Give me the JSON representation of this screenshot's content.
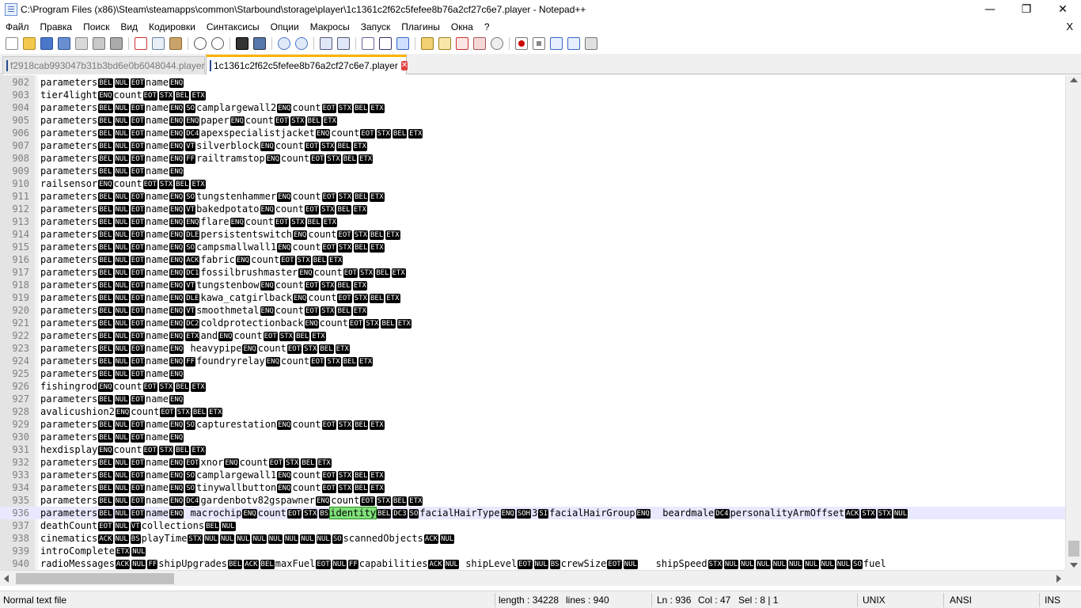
{
  "window": {
    "title": "C:\\Program Files (x86)\\Steam\\steamapps\\common\\Starbound\\storage\\player\\1c1361c2f62c5fefee8b76a2cf27c6e7.player - Notepad++",
    "minimize": "—",
    "maximize": "❐",
    "close": "✕"
  },
  "menu": {
    "items": [
      "Файл",
      "Правка",
      "Поиск",
      "Вид",
      "Кодировки",
      "Синтаксисы",
      "Опции",
      "Макросы",
      "Запуск",
      "Плагины",
      "Окна",
      "?"
    ],
    "close_doc": "X"
  },
  "toolbar": {
    "icons": [
      "new-file-icon",
      "open-file-icon",
      "save-icon",
      "save-all-icon",
      "close-icon",
      "close-all-icon",
      "print-icon",
      "cut-icon",
      "copy-icon",
      "paste-icon",
      "undo-icon",
      "redo-icon",
      "find-icon",
      "replace-icon",
      "zoom-in-icon",
      "zoom-out-icon",
      "sync-vertical-icon",
      "sync-horizontal-icon",
      "word-wrap-icon",
      "show-all-characters-icon",
      "indent-guide-icon",
      "user-defined-language-icon",
      "document-map-icon",
      "function-list-icon",
      "folder-as-workspace-icon",
      "monitoring-icon",
      "record-macro-icon",
      "stop-recording-icon",
      "playback-macro-icon",
      "run-macro-multiple-icon",
      "save-macro-icon"
    ]
  },
  "tabs": [
    {
      "label": "f2918cab993047b31b3bd6e0b6048044.player",
      "active": false
    },
    {
      "label": "1c1361c2f62c5fefee8b76a2cf27c6e7.player",
      "active": true,
      "close": "✕"
    }
  ],
  "editor": {
    "lines": [
      {
        "n": "902",
        "t": "parameters[BEL][NUL][EOT]name[ENQ]"
      },
      {
        "n": "903",
        "t": "tier4light[ENQ]count[EOT][STX][BEL][ETX]"
      },
      {
        "n": "904",
        "t": "parameters[BEL][NUL][EOT]name[ENQ][SO]camplargewall2[ENQ]count[EOT][STX][BEL][ETX]"
      },
      {
        "n": "905",
        "t": "parameters[BEL][NUL][EOT]name[ENQ][ENQ]paper[ENQ]count[EOT][STX][BEL][ETX]"
      },
      {
        "n": "906",
        "t": "parameters[BEL][NUL][EOT]name[ENQ][DC4]apexspecialistjacket[ENQ]count[EOT][STX][BEL][ETX]"
      },
      {
        "n": "907",
        "t": "parameters[BEL][NUL][EOT]name[ENQ][VT]silverblock[ENQ]count[EOT][STX][BEL][ETX]"
      },
      {
        "n": "908",
        "t": "parameters[BEL][NUL][EOT]name[ENQ][FF]railtramstop[ENQ]count[EOT][STX][BEL][ETX]"
      },
      {
        "n": "909",
        "t": "parameters[BEL][NUL][EOT]name[ENQ]"
      },
      {
        "n": "910",
        "t": "railsensor[ENQ]count[EOT][STX][BEL][ETX]"
      },
      {
        "n": "911",
        "t": "parameters[BEL][NUL][EOT]name[ENQ][SO]tungstenhammer[ENQ]count[EOT][STX][BEL][ETX]"
      },
      {
        "n": "912",
        "t": "parameters[BEL][NUL][EOT]name[ENQ][VT]bakedpotato[ENQ]count[EOT][STX][BEL][ETX]"
      },
      {
        "n": "913",
        "t": "parameters[BEL][NUL][EOT]name[ENQ][ENQ]flare[ENQ]count[EOT][STX][BEL][ETX]"
      },
      {
        "n": "914",
        "t": "parameters[BEL][NUL][EOT]name[ENQ][DLE]persistentswitch[ENQ]count[EOT][STX][BEL][ETX]"
      },
      {
        "n": "915",
        "t": "parameters[BEL][NUL][EOT]name[ENQ][SO]campsmallwall1[ENQ]count[EOT][STX][BEL][ETX]"
      },
      {
        "n": "916",
        "t": "parameters[BEL][NUL][EOT]name[ENQ][ACK]fabric[ENQ]count[EOT][STX][BEL][ETX]"
      },
      {
        "n": "917",
        "t": "parameters[BEL][NUL][EOT]name[ENQ][DC1]fossilbrushmaster[ENQ]count[EOT][STX][BEL][ETX]"
      },
      {
        "n": "918",
        "t": "parameters[BEL][NUL][EOT]name[ENQ][VT]tungstenbow[ENQ]count[EOT][STX][BEL][ETX]"
      },
      {
        "n": "919",
        "t": "parameters[BEL][NUL][EOT]name[ENQ][DLE]kawa_catgirlback[ENQ]count[EOT][STX][BEL][ETX]"
      },
      {
        "n": "920",
        "t": "parameters[BEL][NUL][EOT]name[ENQ][VT]smoothmetal[ENQ]count[EOT][STX][BEL][ETX]"
      },
      {
        "n": "921",
        "t": "parameters[BEL][NUL][EOT]name[ENQ][DC2]coldprotectionback[ENQ]count[EOT][STX][BEL][ETX]"
      },
      {
        "n": "922",
        "t": "parameters[BEL][NUL][EOT]name[ENQ][ETX]and[ENQ]count[EOT][STX][BEL][ETX]"
      },
      {
        "n": "923",
        "t": "parameters[BEL][NUL][EOT]name[ENQ] heavypipe[ENQ]count[EOT][STX][BEL][ETX]"
      },
      {
        "n": "924",
        "t": "parameters[BEL][NUL][EOT]name[ENQ][FF]foundryrelay[ENQ]count[EOT][STX][BEL][ETX]"
      },
      {
        "n": "925",
        "t": "parameters[BEL][NUL][EOT]name[ENQ]"
      },
      {
        "n": "926",
        "t": "fishingrod[ENQ]count[EOT][STX][BEL][ETX]"
      },
      {
        "n": "927",
        "t": "parameters[BEL][NUL][EOT]name[ENQ]"
      },
      {
        "n": "928",
        "t": "avalicushion2[ENQ]count[EOT][STX][BEL][ETX]"
      },
      {
        "n": "929",
        "t": "parameters[BEL][NUL][EOT]name[ENQ][SO]capturestation[ENQ]count[EOT][STX][BEL][ETX]"
      },
      {
        "n": "930",
        "t": "parameters[BEL][NUL][EOT]name[ENQ]"
      },
      {
        "n": "931",
        "t": "hexdisplay[ENQ]count[EOT][STX][BEL][ETX]"
      },
      {
        "n": "932",
        "t": "parameters[BEL][NUL][EOT]name[ENQ][EOT]xnor[ENQ]count[EOT][STX][BEL][ETX]"
      },
      {
        "n": "933",
        "t": "parameters[BEL][NUL][EOT]name[ENQ][SO]camplargewall1[ENQ]count[EOT][STX][BEL][ETX]"
      },
      {
        "n": "934",
        "t": "parameters[BEL][NUL][EOT]name[ENQ][SO]tinywallbutton[ENQ]count[EOT][STX][BEL][ETX]"
      },
      {
        "n": "935",
        "t": "parameters[BEL][NUL][EOT]name[ENQ][DC4]gardenbotv82gspawner[ENQ]count[EOT][STX][BEL][ETX]"
      },
      {
        "n": "936",
        "t": "parameters[BEL][NUL][EOT]name[ENQ] macrochip[ENQ]count[EOT][STX][BS]{identity}[BEL][DC3][SO]facialHairType[ENQ][SOH]3[SI]facialHairGroup[ENQ]  beardmale[DC4]personalityArmOffset[ACK][STX][STX][NUL]",
        "current": true
      },
      {
        "n": "937",
        "t": "deathCount[EOT][NUL][VT]collections[BEL][NUL]"
      },
      {
        "n": "938",
        "t": "cinematics[ACK][NUL][BS]playTime[STX][NUL][NUL][NUL][NUL][NUL][NUL][NUL][NUL][SO]scannedObjects[ACK][NUL]"
      },
      {
        "n": "939",
        "t": "introComplete[ETX][NUL]"
      },
      {
        "n": "940",
        "t": "radioMessages[ACK][NUL][FF]shipUpgrades[BEL][ACK][BEL]maxFuel[EOT][NUL][FF]capabilities[ACK][NUL] shipLevel[EOT][NUL][BS]crewSize[EOT][NUL]   shipSpeed[STX][NUL][NUL][NUL][NUL][NUL][NUL][NUL][NUL][SO]fuel"
      }
    ]
  },
  "status": {
    "filetype": "Normal text file",
    "length": "length : 34228",
    "lines": "lines : 940",
    "ln": "Ln : 936",
    "col": "Col : 47",
    "sel": "Sel : 8 | 1",
    "eol": "UNIX",
    "encoding": "ANSI",
    "mode": "INS"
  }
}
